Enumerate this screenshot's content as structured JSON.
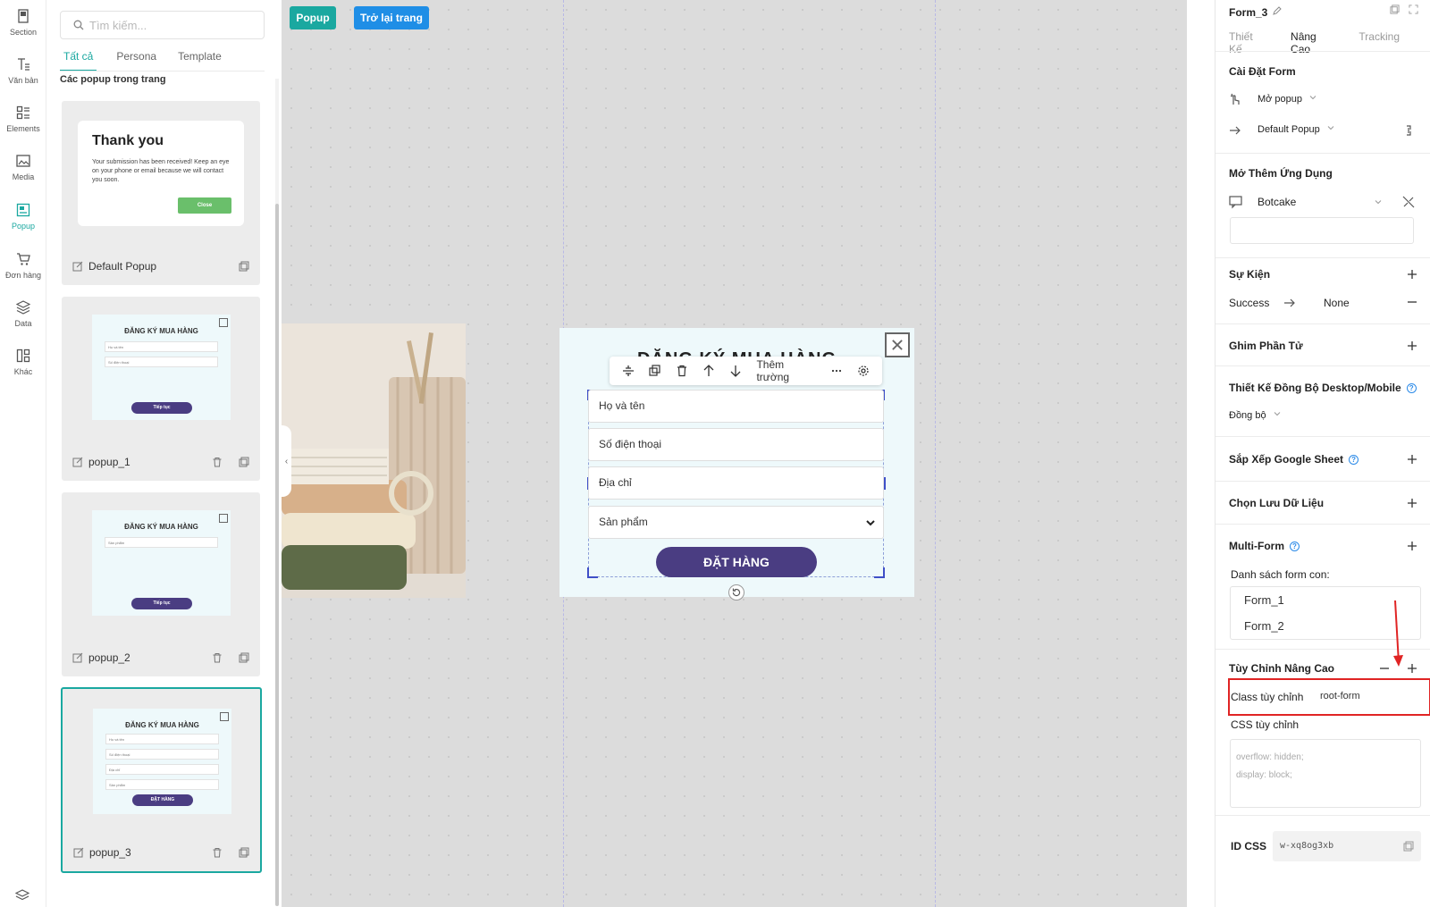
{
  "rail": [
    {
      "label": "Section",
      "icon": "section-icon"
    },
    {
      "label": "Văn bản",
      "icon": "text-icon"
    },
    {
      "label": "Elements",
      "icon": "elements-icon"
    },
    {
      "label": "Media",
      "icon": "media-icon"
    },
    {
      "label": "Popup",
      "icon": "popup-icon",
      "active": true
    },
    {
      "label": "Đơn hàng",
      "icon": "cart-icon"
    },
    {
      "label": "Data",
      "icon": "data-icon"
    },
    {
      "label": "Khác",
      "icon": "other-icon"
    }
  ],
  "panel": {
    "search_placeholder": "Tìm kiếm...",
    "tabs": [
      "Tất cả",
      "Persona",
      "Template"
    ],
    "section_title": "Các popup trong trang",
    "cards": [
      {
        "name": "Default Popup",
        "thumb_title": "Thank you",
        "thumb_text": "Your submission has been received! Keep an eye on your phone or email because we will contact you soon.",
        "thumb_button": "Close"
      },
      {
        "name": "popup_1",
        "thumb_title": "ĐĂNG KÝ MUA HÀNG",
        "fields": [
          "Họ và tên",
          "Số điện thoại"
        ],
        "thumb_button": "Tiếp tục"
      },
      {
        "name": "popup_2",
        "thumb_title": "ĐĂNG KÝ MUA HÀNG",
        "fields": [
          "Sản phẩm"
        ],
        "thumb_button": "Tiếp tục"
      },
      {
        "name": "popup_3",
        "thumb_title": "ĐĂNG KÝ MUA HÀNG",
        "fields": [
          "Họ và tên",
          "Số điện thoại",
          "Địa chỉ",
          "Sản phẩm"
        ],
        "thumb_button": "ĐẶT HÀNG"
      }
    ]
  },
  "canvas": {
    "popup_button": "Popup",
    "back_button": "Trở lại trang",
    "popup_title": "ĐĂNG KÝ MUA HÀNG",
    "toolbar_add_field": "Thêm trường",
    "fields": [
      "Họ và tên",
      "Số điện thoại",
      "Địa chỉ",
      "Sản phẩm"
    ],
    "order_button": "ĐẶT HÀNG"
  },
  "right": {
    "form_name": "Form_3",
    "tabs": [
      "Thiết Kế",
      "Nâng Cao",
      "Tracking"
    ],
    "form_settings": "Cài Đặt Form",
    "open_popup": "Mở popup",
    "default_popup": "Default Popup",
    "open_app": "Mở Thêm Ứng Dụng",
    "app_name": "Botcake",
    "events": "Sự Kiện",
    "success": "Success",
    "none": "None",
    "pin": "Ghim Phần Tử",
    "sync_design": "Thiết Kế Đồng Bộ Desktop/Mobile",
    "sync_value": "Đồng bộ",
    "google_sheet": "Sắp Xếp Google Sheet",
    "save_data": "Chọn Lưu Dữ Liệu",
    "multi_form": "Multi-Form",
    "subform_list_label": "Danh sách form con:",
    "subforms": [
      "Form_1",
      "Form_2"
    ],
    "advanced": "Tùy Chỉnh Nâng Cao",
    "custom_class_label": "Class tùy chỉnh",
    "custom_class_value": "root-form",
    "custom_css_label": "CSS tùy chỉnh",
    "css_placeholder_1": "overflow: hidden;",
    "css_placeholder_2": "display: block;",
    "id_css_label": "ID CSS",
    "id_css_value": "w-xq8og3xb"
  },
  "colors": {
    "accent": "#1aa8a0",
    "blue": "#1f8ee6",
    "form_button": "#4a3d82",
    "highlight": "#e02424"
  }
}
